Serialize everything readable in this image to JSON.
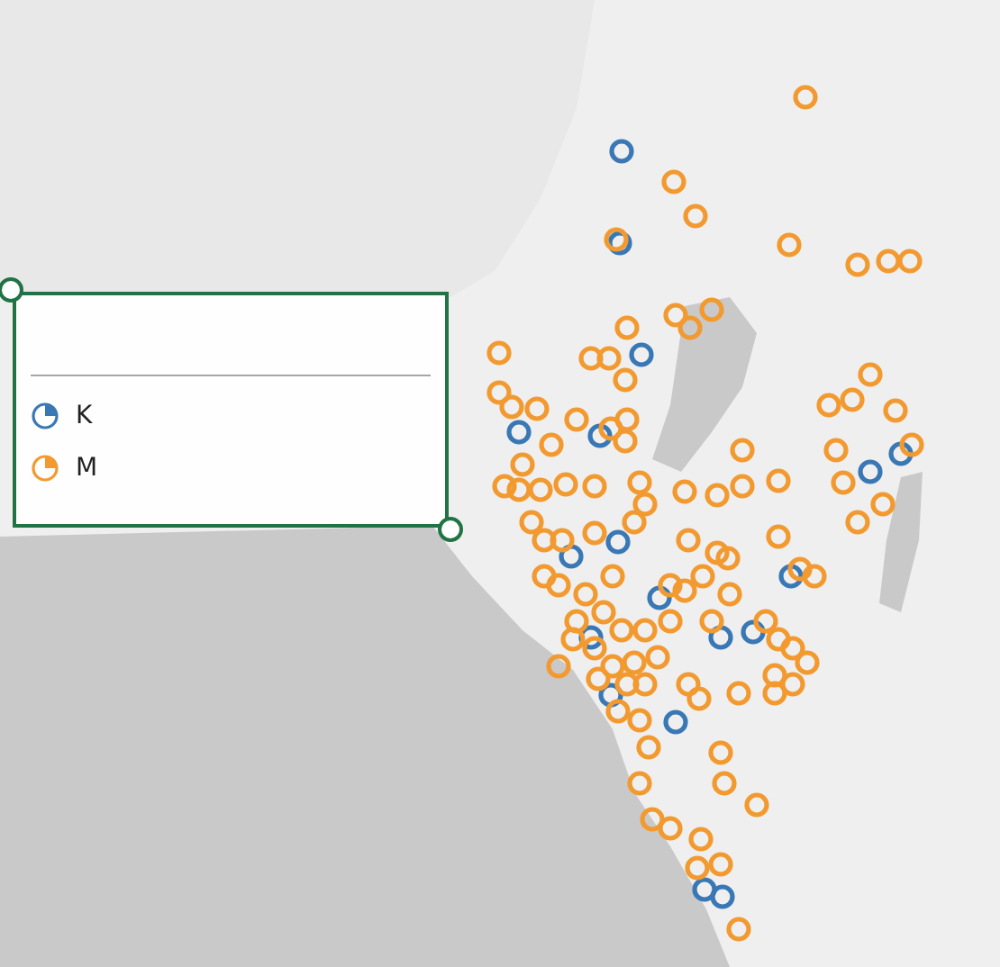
{
  "legend": {
    "items": [
      {
        "label": "K",
        "color": "#3a78b5"
      },
      {
        "label": "M",
        "color": "#f29a30"
      }
    ]
  }
}
